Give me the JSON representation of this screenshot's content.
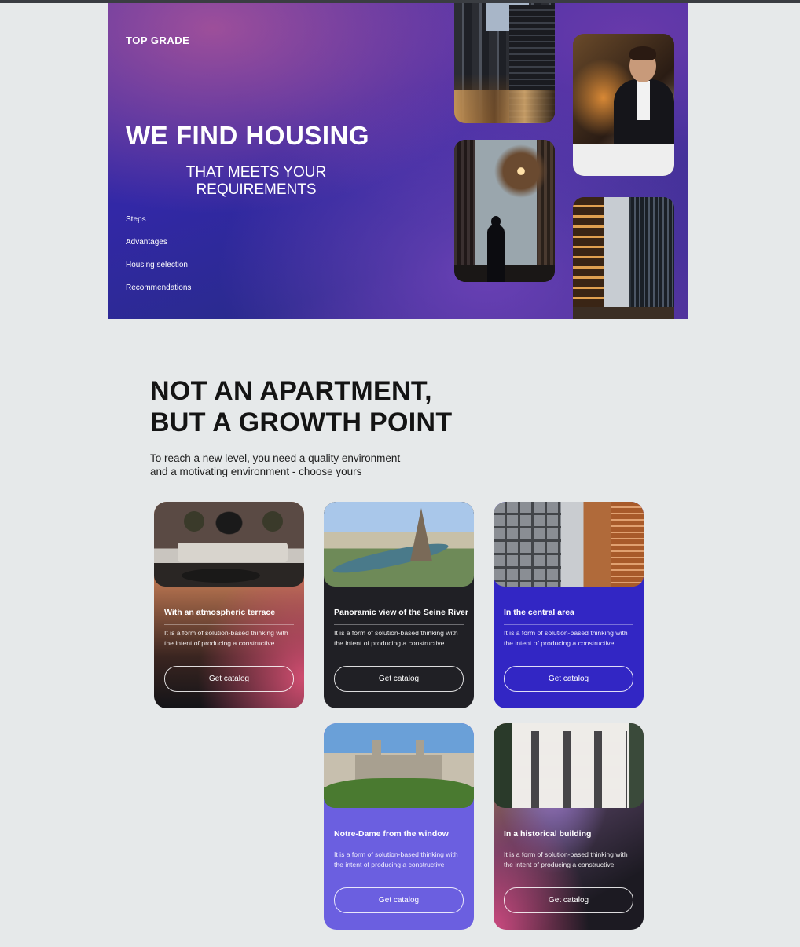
{
  "hero": {
    "brand": "TOP GRADE",
    "title": "WE FIND HOUSING",
    "subtitle": "THAT MEETS YOUR REQUIREMENTS",
    "nav": [
      "Steps",
      "Advantages",
      "Housing selection",
      "Recommendations"
    ]
  },
  "section": {
    "title_line1": "NOT AN APARTMENT,",
    "title_line2": "BUT A GROWTH POINT",
    "desc_line1": "To reach a new level, you need a quality environment",
    "desc_line2": "and a motivating environment - choose yours"
  },
  "cards": [
    {
      "title": "With an atmospheric terrace",
      "text": "It is a form of solution-based thinking with the intent of producing a constructive",
      "button": "Get catalog",
      "bg": "#b2704e"
    },
    {
      "title": "Panoramic view of the Seine River",
      "text": "It is a form of solution-based thinking with the intent of producing a constructive",
      "button": "Get catalog",
      "bg": "#202025"
    },
    {
      "title": "In the central area",
      "text": "It is a form of solution-based thinking with the intent of producing a constructive",
      "button": "Get catalog",
      "bg": "#3226c4"
    },
    {
      "title": "Notre-Dame from the window",
      "text": "It is a form of solution-based thinking with the intent of producing a constructive",
      "button": "Get catalog",
      "bg": "#6b5fe0"
    },
    {
      "title": "In a historical building",
      "text": "It is a form of solution-based thinking with the intent of producing a constructive",
      "button": "Get catalog",
      "bg": "#1c1a22"
    }
  ]
}
